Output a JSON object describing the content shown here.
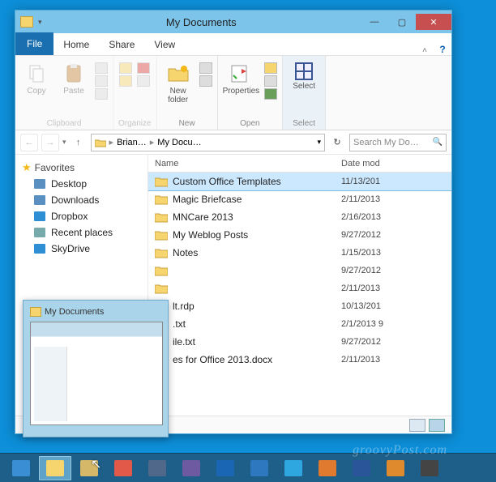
{
  "window": {
    "title": "My Documents",
    "minimize": "—",
    "maximize": "▢",
    "close": "✕"
  },
  "menubar": {
    "file": "File",
    "home": "Home",
    "share": "Share",
    "view": "View",
    "help": "?"
  },
  "ribbon": {
    "clipboard": {
      "label": "Clipboard",
      "copy": "Copy",
      "paste": "Paste"
    },
    "organize": {
      "label": "Organize"
    },
    "new": {
      "label": "New",
      "newfolder": "New\nfolder"
    },
    "open": {
      "label": "Open",
      "properties": "Properties"
    },
    "select": {
      "label": "Select",
      "btn": "Select"
    }
  },
  "nav": {
    "back": "←",
    "fwd": "→",
    "down": "▾",
    "up": "↑",
    "crumb1": "Brian…",
    "crumb2": "My Docu…",
    "dd": "▾",
    "refresh": "↻",
    "search_placeholder": "Search My Do…",
    "search_icon": "🔍"
  },
  "sidebar": {
    "favorites": "Favorites",
    "items": [
      {
        "label": "Desktop",
        "icon": "desktop"
      },
      {
        "label": "Downloads",
        "icon": "downloads"
      },
      {
        "label": "Dropbox",
        "icon": "dropbox"
      },
      {
        "label": "Recent places",
        "icon": "recent"
      },
      {
        "label": "SkyDrive",
        "icon": "skydrive"
      }
    ]
  },
  "columns": {
    "name": "Name",
    "date": "Date mod"
  },
  "files": [
    {
      "name": "Custom Office Templates",
      "date": "11/13/201",
      "type": "folder",
      "selected": true
    },
    {
      "name": "Magic Briefcase",
      "date": "2/11/2013",
      "type": "folder"
    },
    {
      "name": "MNCare 2013",
      "date": "2/16/2013",
      "type": "folder"
    },
    {
      "name": "My Weblog Posts",
      "date": "9/27/2012",
      "type": "folder"
    },
    {
      "name": "Notes",
      "date": "1/15/2013",
      "type": "folder"
    },
    {
      "name": "",
      "date": "9/27/2012",
      "type": "folder"
    },
    {
      "name": "",
      "date": "2/11/2013",
      "type": "folder"
    },
    {
      "name": "lt.rdp",
      "date": "10/13/201",
      "type": "file"
    },
    {
      "name": ".txt",
      "date": "2/1/2013 9",
      "type": "file"
    },
    {
      "name": "ile.txt",
      "date": "9/27/2012",
      "type": "file"
    },
    {
      "name": "es for Office 2013.docx",
      "date": "2/11/2013",
      "type": "file"
    }
  ],
  "preview": {
    "title": "My Documents"
  },
  "taskbar": {
    "items": [
      {
        "name": "ie",
        "color": "#3a8fd4"
      },
      {
        "name": "file-explorer",
        "color": "#f7d56e",
        "active": true
      },
      {
        "name": "app1",
        "color": "#d6b968"
      },
      {
        "name": "chrome",
        "color": "#e2594a"
      },
      {
        "name": "steam",
        "color": "#50688a"
      },
      {
        "name": "app2",
        "color": "#6d5aa0"
      },
      {
        "name": "outlook",
        "color": "#1b66b4"
      },
      {
        "name": "app3",
        "color": "#2e78c0"
      },
      {
        "name": "skype",
        "color": "#2ea6e0"
      },
      {
        "name": "firefox",
        "color": "#e07a2e"
      },
      {
        "name": "word",
        "color": "#2a5699"
      },
      {
        "name": "vlc",
        "color": "#e08a2e"
      },
      {
        "name": "app4",
        "color": "#444"
      }
    ]
  },
  "watermark": "groovyPost.com"
}
